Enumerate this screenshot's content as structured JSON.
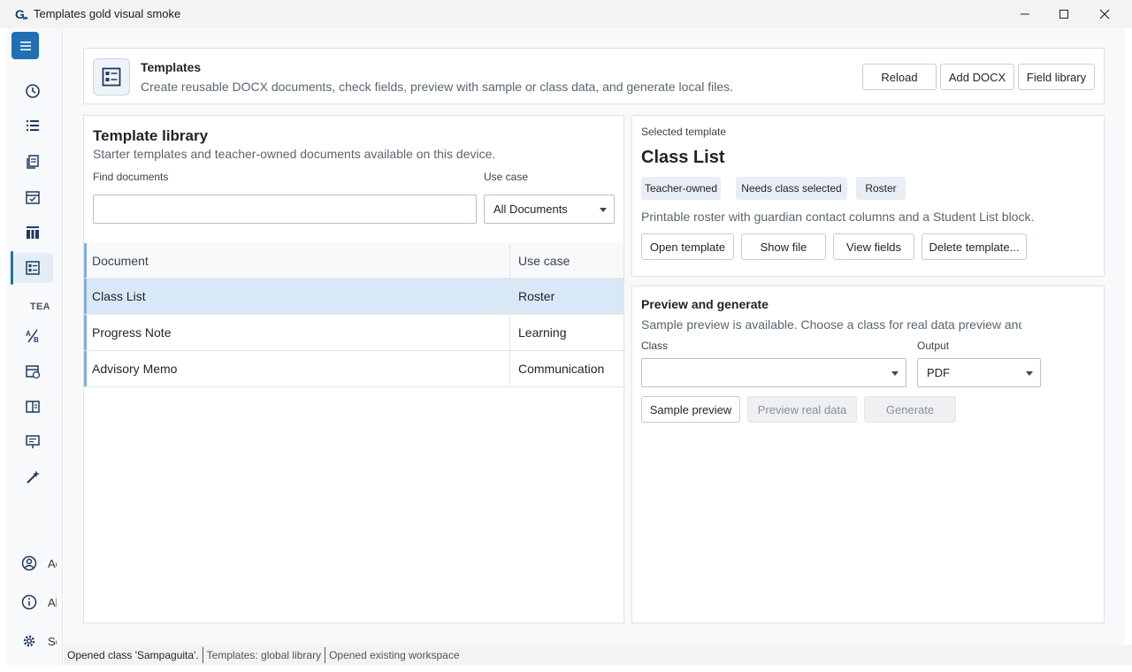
{
  "window": {
    "title": "Templates gold visual smoke",
    "logo_icon": "app-logo-icon"
  },
  "rail": {
    "section_label": "TEACHER",
    "bottom_items": [
      {
        "icon": "account-icon",
        "label": "Account"
      },
      {
        "icon": "info-icon",
        "label": "About"
      },
      {
        "icon": "settings-icon",
        "label": "Settings"
      }
    ],
    "accent_color": "#1f6fb2"
  },
  "header": {
    "title": "Templates",
    "subtitle": "Create reusable DOCX documents, check fields, preview with sample or class data, and generate local files.",
    "buttons": {
      "reload": "Reload",
      "add_docx": "Add DOCX",
      "field_library": "Field library"
    }
  },
  "library": {
    "title": "Template library",
    "subtitle": "Starter templates and teacher-owned documents available on this device.",
    "find_label": "Find documents",
    "find_value": "",
    "use_case_label": "Use case",
    "use_case_value": "All Documents",
    "columns": {
      "document": "Document",
      "use_case": "Use case"
    },
    "rows": [
      {
        "document": "Class List",
        "use_case": "Roster",
        "selected": true
      },
      {
        "document": "Progress Note",
        "use_case": "Learning",
        "selected": false
      },
      {
        "document": "Advisory Memo",
        "use_case": "Communication",
        "selected": false
      }
    ]
  },
  "selected": {
    "eyebrow": "Selected template",
    "name": "Class List",
    "chips": {
      "owner": "Teacher-owned",
      "requirement": "Needs class selected",
      "use_case": "Roster"
    },
    "description": "Printable roster with guardian contact columns and a Student List block.",
    "buttons": {
      "open": "Open template",
      "show_file": "Show file",
      "view_fields": "View fields",
      "delete": "Delete template..."
    }
  },
  "preview": {
    "title": "Preview and generate",
    "subtitle": "Sample preview is available. Choose a class for real data preview and g",
    "class_label": "Class",
    "class_value": "",
    "output_label": "Output",
    "output_value": "PDF",
    "buttons": {
      "sample": "Sample preview",
      "real": "Preview real data",
      "generate": "Generate"
    }
  },
  "status": {
    "message": "Opened class 'Sampaguita'.",
    "templates": "Templates: global library",
    "workspace": "Opened existing workspace"
  }
}
